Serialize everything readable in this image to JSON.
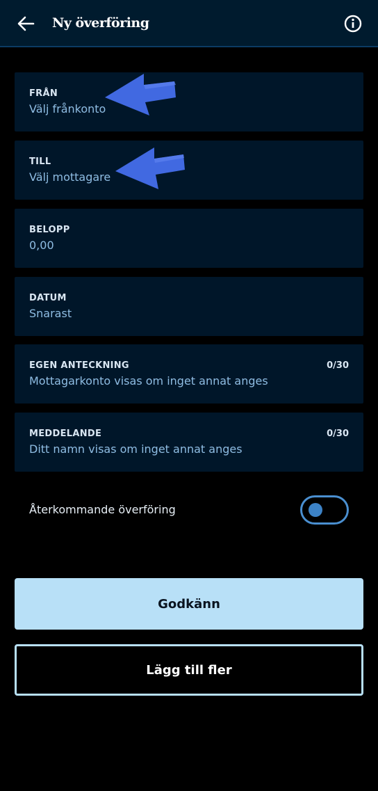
{
  "header": {
    "title": "Ny överföring",
    "back_icon": "arrow-left-icon",
    "info_icon": "info-circle-icon"
  },
  "fields": {
    "from": {
      "label": "FRÅN",
      "value": "Välj frånkonto"
    },
    "to": {
      "label": "TILL",
      "value": "Välj mottagare"
    },
    "amount": {
      "label": "BELOPP",
      "value": "0,00"
    },
    "date": {
      "label": "DATUM",
      "value": "Snarast"
    },
    "own_note": {
      "label": "EGEN ANTECKNING",
      "value": "Mottagarkonto visas om inget annat anges",
      "counter": "0/30"
    },
    "message": {
      "label": "MEDDELANDE",
      "value": "Ditt namn visas om inget annat anges",
      "counter": "0/30"
    }
  },
  "recurring": {
    "label": "Återkommande överföring",
    "enabled": false
  },
  "buttons": {
    "approve": "Godkänn",
    "add_more": "Lägg till fler"
  },
  "colors": {
    "header_bg": "#001b2e",
    "field_bg": "#001629",
    "value_text": "#8fbde3",
    "primary_button": "#b8e0f7",
    "annotation_arrow": "#4169e1"
  }
}
